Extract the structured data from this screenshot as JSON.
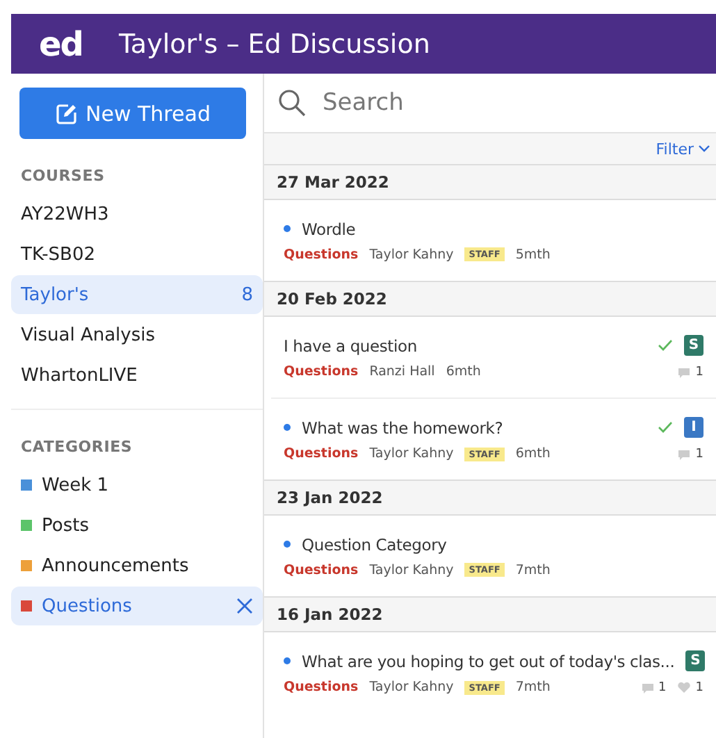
{
  "header": {
    "logo": "ed",
    "title": "Taylor's – Ed Discussion"
  },
  "new_thread_button": "New Thread",
  "search": {
    "placeholder": "Search"
  },
  "filter": "Filter",
  "courses": {
    "heading": "COURSES",
    "items": [
      {
        "label": "AY22WH3",
        "selected": false
      },
      {
        "label": "TK-SB02",
        "selected": false
      },
      {
        "label": "Taylor's",
        "selected": true,
        "count": "8"
      },
      {
        "label": "Visual Analysis",
        "selected": false
      },
      {
        "label": "WhartonLIVE",
        "selected": false
      }
    ]
  },
  "categories": {
    "heading": "CATEGORIES",
    "items": [
      {
        "label": "Week 1",
        "color": "#4a90d9",
        "selected": false
      },
      {
        "label": "Posts",
        "color": "#5cc46a",
        "selected": false
      },
      {
        "label": "Announcements",
        "color": "#eda03a",
        "selected": false
      },
      {
        "label": "Questions",
        "color": "#d9483b",
        "selected": true
      }
    ]
  },
  "groups": [
    {
      "date": "27 Mar 2022",
      "threads": [
        {
          "title": "Wordle",
          "unread": true,
          "category": "Questions",
          "author": "Taylor Kahny",
          "staff": "STAFF",
          "time": "5mth",
          "answered": false
        }
      ]
    },
    {
      "date": "20 Feb 2022",
      "threads": [
        {
          "title": "I have a question",
          "unread": false,
          "category": "Questions",
          "author": "Ranzi Hall",
          "time": "6mth",
          "answered": true,
          "badge": {
            "letter": "S",
            "color": "#2f7a68"
          },
          "comments": "1"
        },
        {
          "title": "What was the homework?",
          "unread": true,
          "category": "Questions",
          "author": "Taylor Kahny",
          "staff": "STAFF",
          "time": "6mth",
          "answered": true,
          "badge": {
            "letter": "I",
            "color": "#3a78c4"
          },
          "comments": "1"
        }
      ]
    },
    {
      "date": "23 Jan 2022",
      "threads": [
        {
          "title": "Question Category",
          "unread": true,
          "category": "Questions",
          "author": "Taylor Kahny",
          "staff": "STAFF",
          "time": "7mth",
          "answered": false
        }
      ]
    },
    {
      "date": "16 Jan 2022",
      "threads": [
        {
          "title": "What are you hoping to get out of today's clas...",
          "unread": true,
          "category": "Questions",
          "author": "Taylor Kahny",
          "staff": "STAFF",
          "time": "7mth",
          "answered": false,
          "badge": {
            "letter": "S",
            "color": "#2f7a68"
          },
          "comments": "1",
          "likes": "1"
        }
      ]
    }
  ]
}
